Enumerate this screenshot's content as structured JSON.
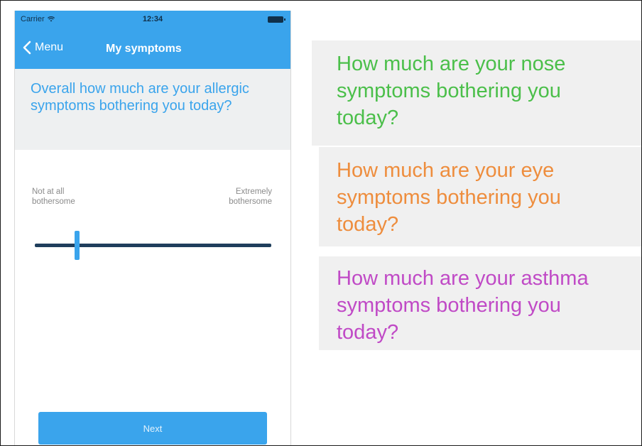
{
  "status_bar": {
    "carrier": "Carrier",
    "time": "12:34"
  },
  "nav": {
    "back_label": "Menu",
    "title": "My symptoms"
  },
  "main_question": "Overall how much are your allergic symptoms bothering you today?",
  "scale": {
    "left_label_line1": "Not at all",
    "left_label_line2": "bothersome",
    "right_label_line1": "Extremely",
    "right_label_line2": "bothersome",
    "value_fraction": 0.18
  },
  "next_button": "Next",
  "cards": {
    "nose": {
      "line1": "How much are your nose",
      "line2": "symptoms bothering you",
      "line3": "today?",
      "color": "#4bbf4a"
    },
    "eye": {
      "line1": "How much are your eye",
      "line2": "symptoms bothering you",
      "line3": "today?",
      "color": "#ee8d3d"
    },
    "asthma": {
      "line1": "How much are your asthma",
      "line2": "symptoms bothering you",
      "line3": "today?",
      "color": "#c04ac6"
    }
  },
  "colors": {
    "accent": "#3aa4ec",
    "slider_track": "#1f3e5c",
    "panel_bg": "#eef0f1"
  },
  "icons": {
    "wifi": "wifi-icon",
    "battery": "battery-icon",
    "back": "chevron-left-icon"
  }
}
